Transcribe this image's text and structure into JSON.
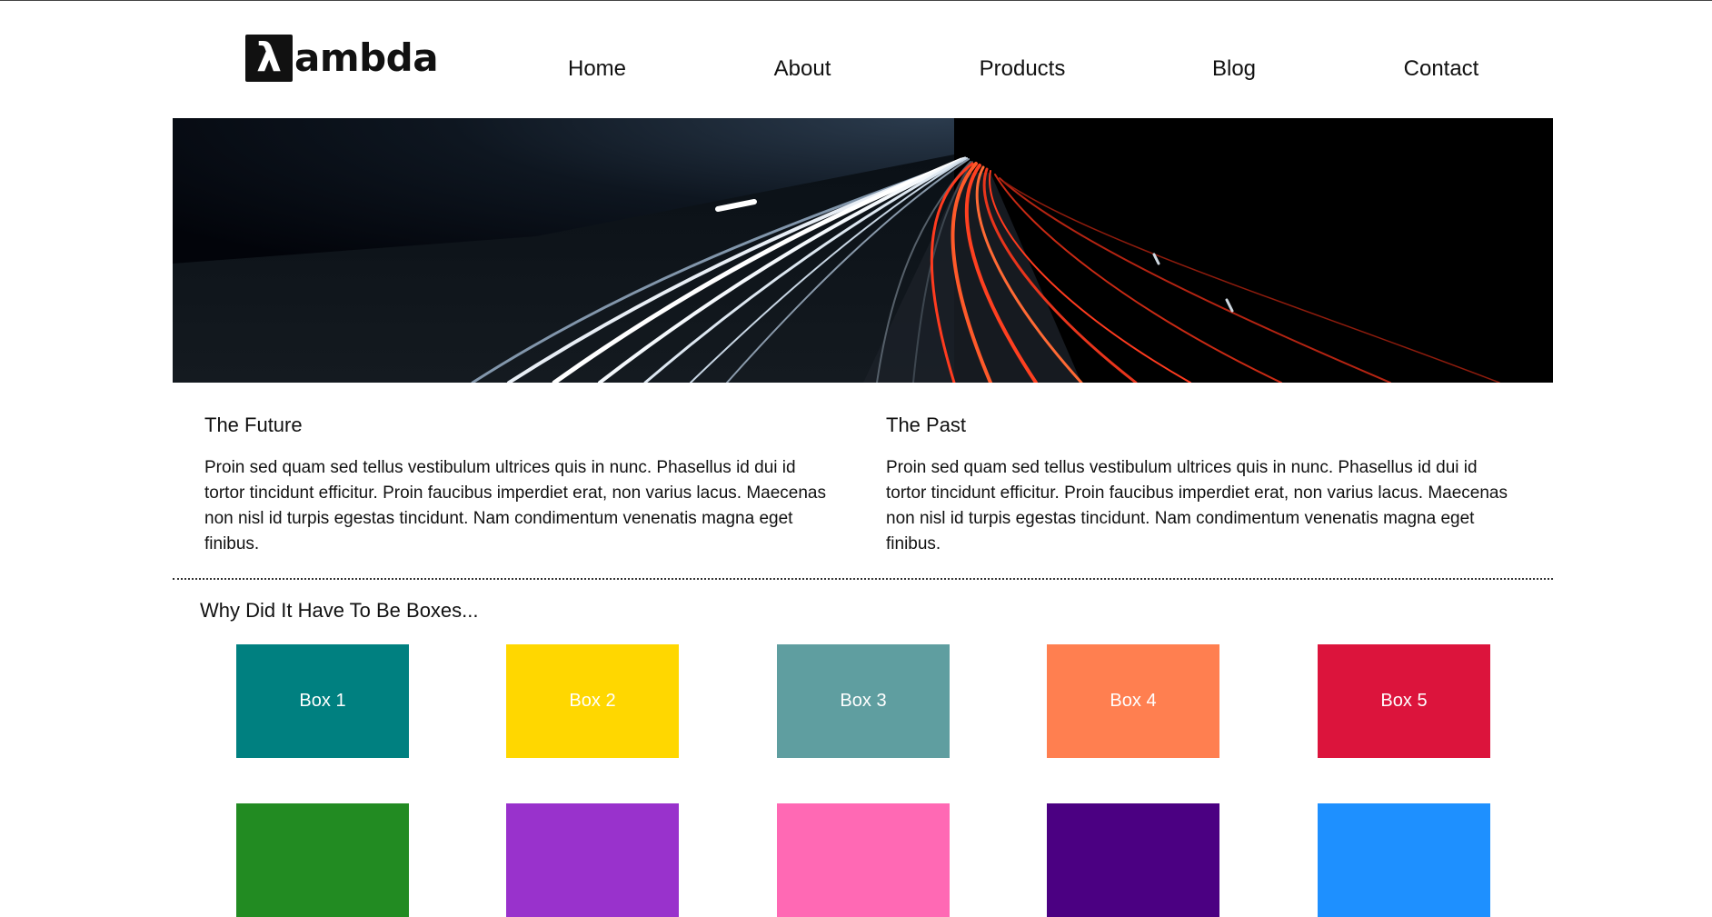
{
  "header": {
    "logo_mark": "λ",
    "logo_text": "ambda",
    "nav": [
      "Home",
      "About",
      "Products",
      "Blog",
      "Contact"
    ]
  },
  "hero": {
    "alt": "Long-exposure highway at night with white and red light trails"
  },
  "columns": [
    {
      "title": "The Future",
      "body": "Proin sed quam sed tellus vestibulum ultrices quis in nunc. Phasellus id dui id tortor tincidunt efficitur. Proin faucibus imperdiet erat, non varius lacus. Maecenas non nisl id turpis egestas tincidunt. Nam condimentum venenatis magna eget finibus."
    },
    {
      "title": "The Past",
      "body": "Proin sed quam sed tellus vestibulum ultrices quis in nunc. Phasellus id dui id tortor tincidunt efficitur. Proin faucibus imperdiet erat, non varius lacus. Maecenas non nisl id turpis egestas tincidunt. Nam condimentum venenatis magna eget finibus."
    }
  ],
  "boxes_section": {
    "title": "Why Did It Have To Be Boxes..."
  },
  "boxes": [
    {
      "label": "Box 1",
      "color": "#008080"
    },
    {
      "label": "Box 2",
      "color": "#FFD700"
    },
    {
      "label": "Box 3",
      "color": "#5F9EA0"
    },
    {
      "label": "Box 4",
      "color": "#FF7F50"
    },
    {
      "label": "Box 5",
      "color": "#DC143C"
    },
    {
      "label": "",
      "color": "#228B22"
    },
    {
      "label": "",
      "color": "#9932CC"
    },
    {
      "label": "",
      "color": "#FF69B4"
    },
    {
      "label": "",
      "color": "#4B0082"
    },
    {
      "label": "",
      "color": "#1E90FF"
    }
  ]
}
